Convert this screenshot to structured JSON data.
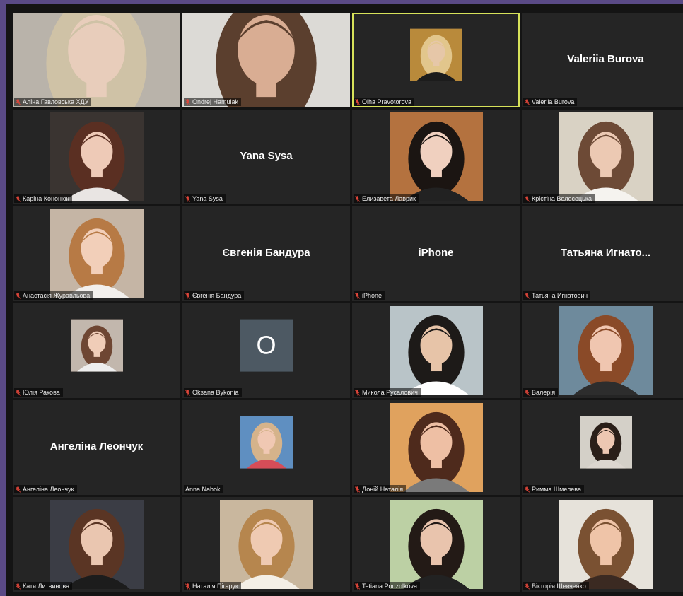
{
  "participants": [
    {
      "name": "Аліна Гавловська ХДУ",
      "mode": "video",
      "video": "full",
      "bg": "#b9b3aa",
      "skin": "#e8cdbb",
      "hair": "#cfc2a6",
      "cloth": "#d8d5d0",
      "muted": true
    },
    {
      "name": "Ondrej Hamulak",
      "mode": "video",
      "video": "full",
      "bg": "#dcdad6",
      "skin": "#d9ad93",
      "hair": "#5b3f2e",
      "cloth": "#efefef",
      "muted": true
    },
    {
      "name": "Olha Pravotorova",
      "mode": "video",
      "video": "small",
      "bg": "#b98a3b",
      "skin": "#e6c7a8",
      "hair": "#e2c68c",
      "cloth": "#1c1c1c",
      "muted": true,
      "active": true
    },
    {
      "name": "Valeriia Burova",
      "mode": "name",
      "display": "Valeriia Burova",
      "muted": true
    },
    {
      "name": "Каріна Кононюк",
      "mode": "video",
      "video": "portrait",
      "bg": "#3a3431",
      "skin": "#eecab7",
      "hair": "#5a2f22",
      "cloth": "#e9e5e3",
      "muted": true
    },
    {
      "name": "Yana Sysa",
      "mode": "name",
      "display": "Yana Sysa",
      "muted": true
    },
    {
      "name": "Елизавета Лаврик",
      "mode": "video",
      "video": "portrait",
      "bg": "#b4723f",
      "skin": "#f0d0bf",
      "hair": "#1b1512",
      "cloth": "#222222",
      "muted": true
    },
    {
      "name": "Крістіна Волосецька",
      "mode": "video",
      "video": "portrait",
      "bg": "#d9d2c4",
      "skin": "#ecc9b3",
      "hair": "#6d4a36",
      "cloth": "#f5f3ef",
      "muted": true
    },
    {
      "name": "Анастасія Журавльова",
      "mode": "video",
      "video": "portrait",
      "bg": "#c5b5a5",
      "skin": "#f2cfb9",
      "hair": "#b77a45",
      "cloth": "#f2efec",
      "muted": true
    },
    {
      "name": "Євгенія Бандура",
      "mode": "name",
      "display": "Євгенія Бандура",
      "muted": true
    },
    {
      "name": "iPhone",
      "mode": "name",
      "display": "iPhone",
      "muted": true
    },
    {
      "name": "Татьяна Игнатович",
      "mode": "name",
      "display": "Татьяна  Игнато...",
      "muted": true
    },
    {
      "name": "Юлія Ракова",
      "mode": "video",
      "video": "small",
      "bg": "#c2b7ad",
      "skin": "#f0cdb8",
      "hair": "#6e4633",
      "cloth": "#eeeeee",
      "muted": true
    },
    {
      "name": "Oksana Bykonia",
      "mode": "initial",
      "initial": "O",
      "muted": true
    },
    {
      "name": "Микола Русалович",
      "mode": "video",
      "video": "portrait",
      "bg": "#b9c4c8",
      "skin": "#e7c4a8",
      "hair": "#1d1a18",
      "cloth": "#ffffff",
      "muted": true
    },
    {
      "name": "Валерія",
      "mode": "video",
      "video": "portrait",
      "bg": "#6e8a9c",
      "skin": "#f0c6b0",
      "hair": "#8a4a28",
      "cloth": "#2d2d2d",
      "muted": true
    },
    {
      "name": "Ангеліна Леончук",
      "mode": "name",
      "display": "Ангеліна Леончук",
      "muted": true
    },
    {
      "name": "Anna Nabok",
      "mode": "video",
      "video": "small",
      "bg": "#5f8fc1",
      "skin": "#f0c8b3",
      "hair": "#d5b38b",
      "cloth": "#d64d58",
      "muted": false
    },
    {
      "name": "Доній Наталія",
      "mode": "video",
      "video": "portrait",
      "bg": "#e0a25e",
      "skin": "#eebfa4",
      "hair": "#4e2a1c",
      "cloth": "#7a7a7a",
      "muted": true
    },
    {
      "name": "Римма Шмелева",
      "mode": "video",
      "video": "small",
      "bg": "#d4d0c8",
      "skin": "#edc7b2",
      "hair": "#2a1f19",
      "cloth": "#dcd6cf",
      "muted": true
    },
    {
      "name": "Катя Литвинова",
      "mode": "video",
      "video": "portrait",
      "bg": "#3b3d45",
      "skin": "#eac6b0",
      "hair": "#5a3524",
      "cloth": "#1c1c1c",
      "muted": true
    },
    {
      "name": "Наталія Пігарук",
      "mode": "video",
      "video": "portrait",
      "bg": "#c9b79e",
      "skin": "#efcab2",
      "hair": "#b6864e",
      "cloth": "#f4efe6",
      "muted": true
    },
    {
      "name": "Tetiana Podzolkova",
      "mode": "video",
      "video": "portrait",
      "bg": "#bcd0a4",
      "skin": "#e9c4ad",
      "hair": "#231a16",
      "cloth": "#222222",
      "muted": true
    },
    {
      "name": "Вікторія Шевченко",
      "mode": "video",
      "video": "portrait",
      "bg": "#e6e2da",
      "skin": "#efc4a8",
      "hair": "#7a5132",
      "cloth": "#3b2a22",
      "muted": true
    }
  ],
  "colors": {
    "muted_icon": "#e0463a",
    "active_border": "#d7e25a",
    "tile_bg": "#252525"
  }
}
